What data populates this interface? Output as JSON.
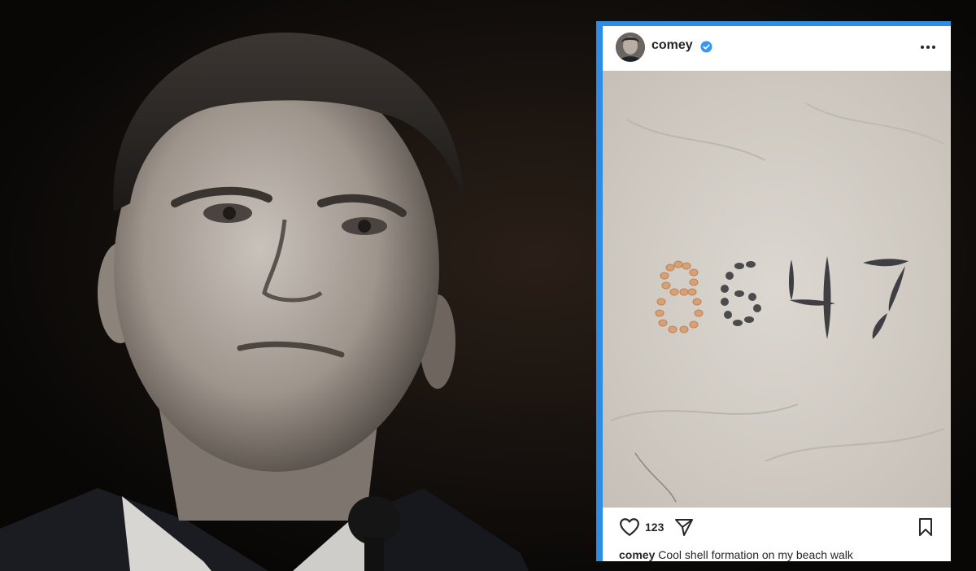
{
  "post": {
    "username": "comey",
    "verified": true,
    "likes": "123",
    "caption_user": "comey",
    "caption_text": "Cool shell formation on my beach walk",
    "shell_text": "8647"
  },
  "icons": {
    "more": "more-icon",
    "like": "heart-icon",
    "share": "send-icon",
    "save": "bookmark-icon",
    "verified": "verified-badge-icon"
  },
  "colors": {
    "frame_blue": "#2f8de6",
    "verified_blue": "#3897f0",
    "sand": "#d8d3cc",
    "background": "#0d0b0a"
  }
}
